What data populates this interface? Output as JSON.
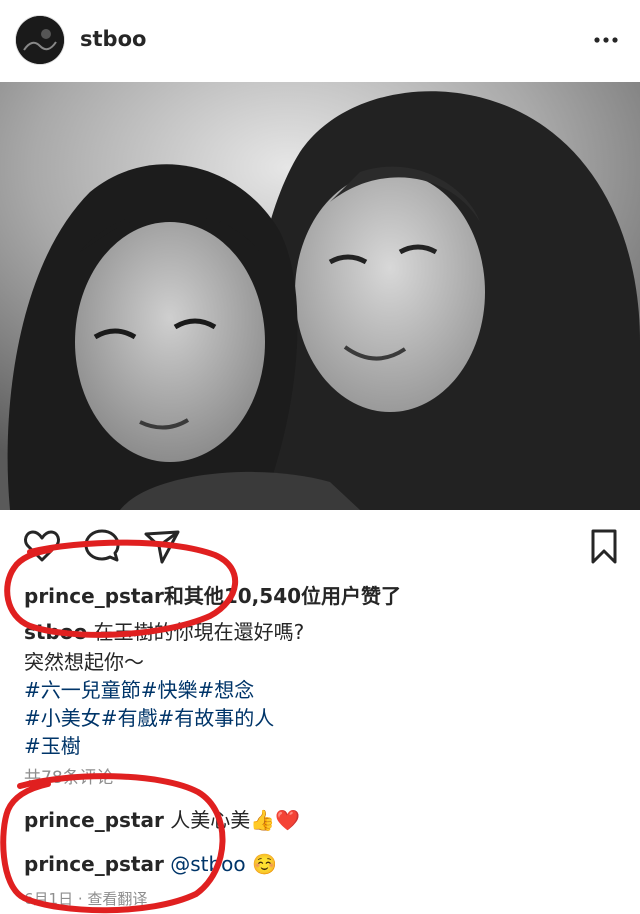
{
  "header": {
    "username": "stboo",
    "more_icon": "more-horizontal-icon"
  },
  "photo": {
    "alt_description": "",
    "tones": "black-and-white"
  },
  "actions": {
    "like_icon": "heart-icon",
    "comment_icon": "comment-icon",
    "share_icon": "send-icon",
    "save_icon": "bookmark-icon"
  },
  "likes": {
    "user": "prince_pstar",
    "rest": "和其他10,540位用户赞了"
  },
  "caption": {
    "user": "stboo",
    "text": " 在玉樹的你現在還好嗎?",
    "line2": "突然想起你～",
    "hashtags_line1": [
      "#六一兒童節",
      "#快樂",
      "#想念"
    ],
    "hashtags_line2": [
      "#小美女",
      "#有戲",
      "#有故事的人"
    ],
    "hashtags_line3": [
      "#玉樹"
    ]
  },
  "comments_link": "共78条评论",
  "comments": [
    {
      "user": "prince_pstar",
      "text": " 人美心美",
      "emoji": "👍❤️"
    },
    {
      "user": "prince_pstar",
      "mention": " @stboo",
      "emoji": " ☺️"
    }
  ],
  "footer": {
    "date": "6月1日",
    "translate": "查看翻译"
  },
  "annotation_color": "#e02020"
}
